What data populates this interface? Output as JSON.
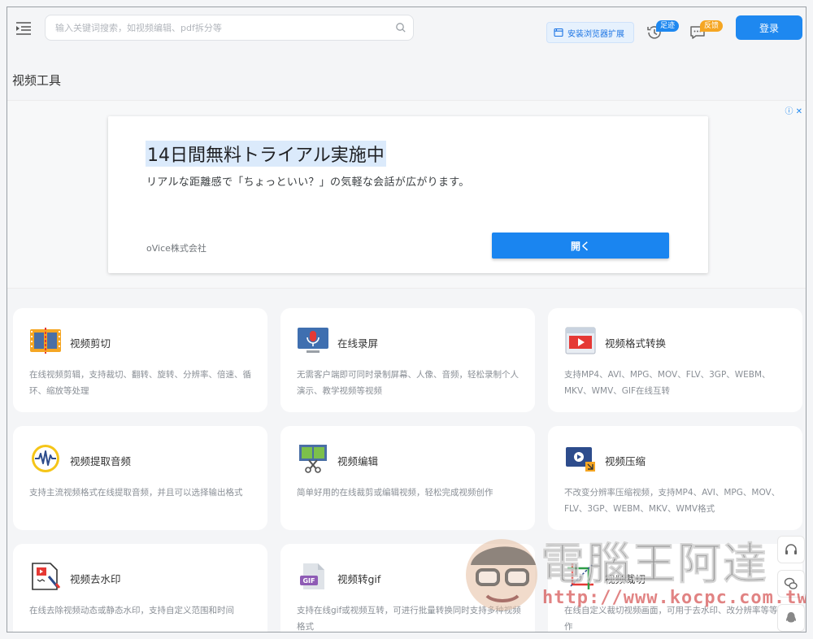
{
  "header": {
    "search_placeholder": "输入关键词搜索，如视频编辑、pdf拆分等",
    "extension_button": "安装浏览器扩展",
    "history_badge": "足迹",
    "feedback_badge": "反馈",
    "login_button": "登录"
  },
  "page_title": "视频工具",
  "ad": {
    "headline": "14日間無料トライアル実施中",
    "subtext": "リアルな距離感で「ちょっといい？」の気軽な会話が広がります。",
    "company": "oVice株式会社",
    "cta": "開く",
    "info_icon": "ⓘ ✕"
  },
  "tools": [
    {
      "title": "视频剪切",
      "desc": "在线视频剪辑，支持裁切、翻转、旋转、分辨率、倍速、循环、缩放等处理",
      "icon": "film-cut-icon"
    },
    {
      "title": "在线录屏",
      "desc": "无需客户端即可同时录制屏幕、人像、音频，轻松录制个人演示、教学视频等视频",
      "icon": "microphone-screen-icon"
    },
    {
      "title": "视频格式转换",
      "desc": "支持MP4、AVI、MPG、MOV、FLV、3GP、WEBM、MKV、WMV、GIF在线互转",
      "icon": "video-convert-icon"
    },
    {
      "title": "视频提取音频",
      "desc": "支持主流视频格式在线提取音频，并且可以选择输出格式",
      "icon": "audio-wave-icon"
    },
    {
      "title": "视频编辑",
      "desc": "简单好用的在线裁剪或编辑视频，轻松完成视频创作",
      "icon": "scissors-film-icon"
    },
    {
      "title": "视频压缩",
      "desc": "不改变分辨率压缩视频，支持MP4、AVI、MPG、MOV、FLV、3GP、WEBM、MKV、WMV格式",
      "icon": "video-compress-icon"
    },
    {
      "title": "视频去水印",
      "desc": "在线去除视频动态或静态水印，支持自定义范围和时间",
      "icon": "watermark-remove-icon"
    },
    {
      "title": "视频转gif",
      "desc": "支持在线gif或视频互转，可进行批量转换同时支持多种视频格式",
      "icon": "gif-file-icon"
    },
    {
      "title": "视频裁切",
      "desc": "在线自定义裁切视频画面，可用于去水印、改分辨率等等操作",
      "icon": "crop-icon"
    }
  ],
  "watermark": {
    "text": "電腦王阿達",
    "url": "http://www.kocpc.com.tw"
  },
  "colors": {
    "accent": "#1e88f0",
    "badge_orange": "#f5a623",
    "background": "#f4f5f7"
  }
}
